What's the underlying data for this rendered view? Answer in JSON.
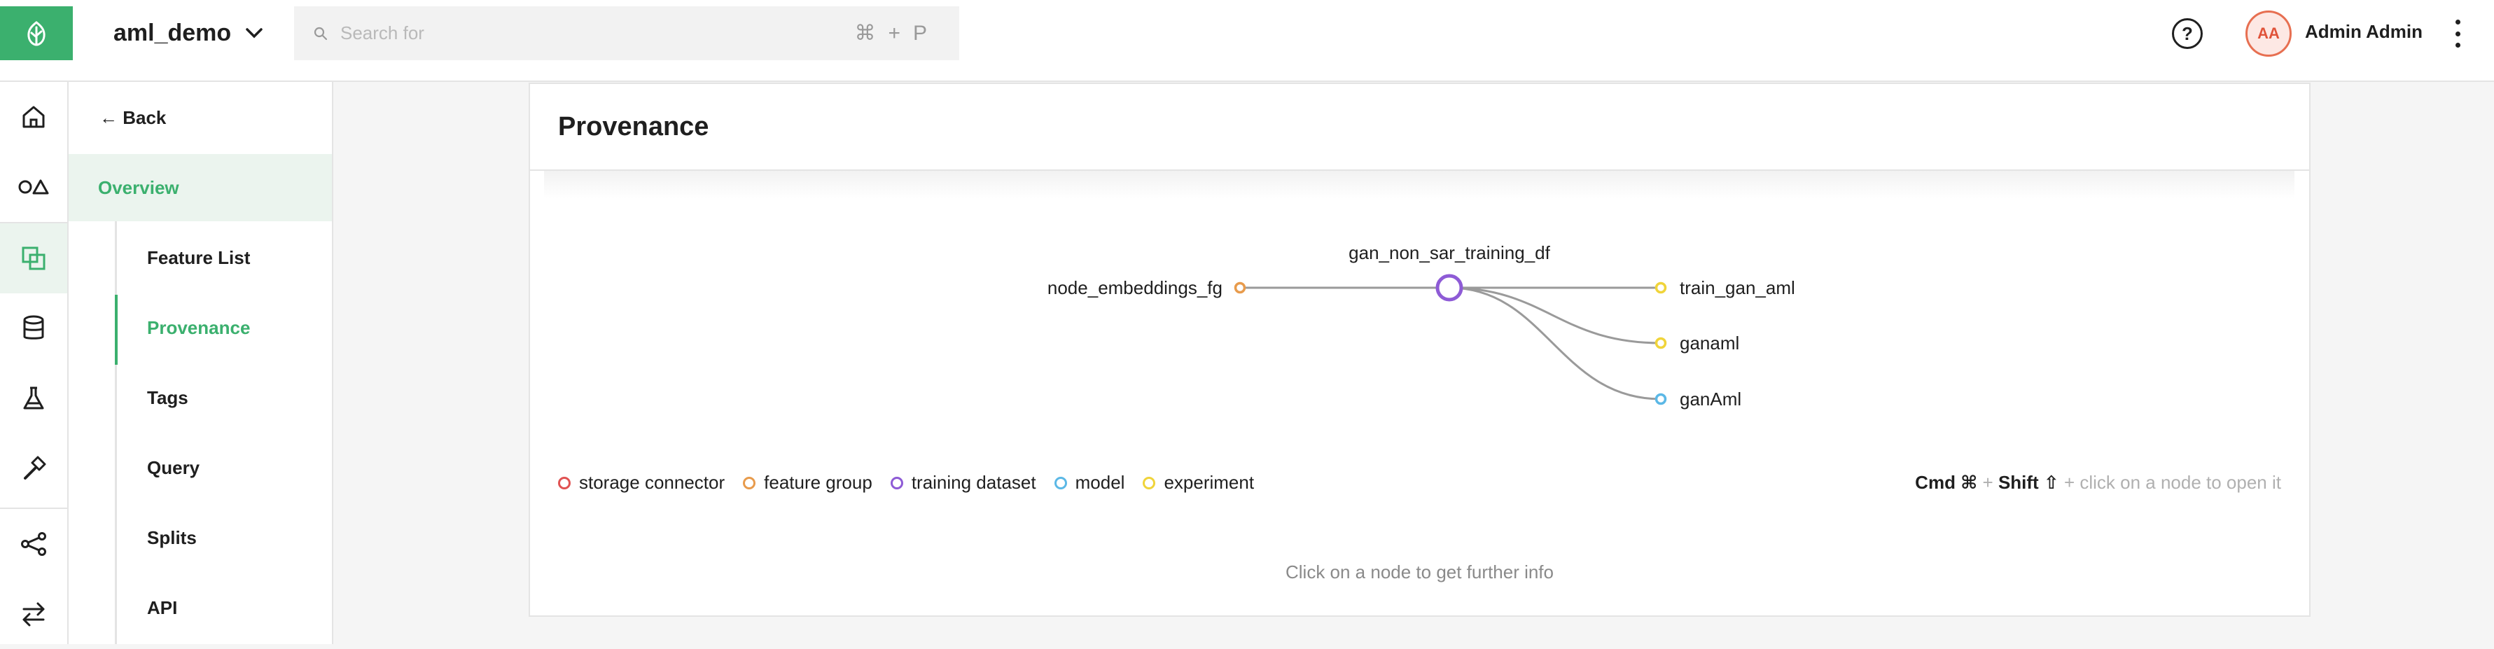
{
  "header": {
    "project_name": "aml_demo",
    "search_placeholder": "Search for",
    "search_shortcut": "⌘+P",
    "help_symbol": "?",
    "user_initials": "AA",
    "user_name": "Admin Admin"
  },
  "rail": {
    "items": [
      {
        "icon": "home-icon"
      },
      {
        "icon": "shapes-icon"
      },
      {
        "icon": "feature-store-icon",
        "active": true
      },
      {
        "icon": "database-icon"
      },
      {
        "icon": "experiment-flask-icon"
      },
      {
        "icon": "hammer-icon"
      },
      {
        "icon": "pipeline-icon"
      },
      {
        "icon": "transfer-arrows-icon"
      }
    ]
  },
  "subnav": {
    "back_label": "Back",
    "overview_label": "Overview",
    "items": [
      {
        "label": "Feature List"
      },
      {
        "label": "Provenance",
        "active": true
      },
      {
        "label": "Tags"
      },
      {
        "label": "Query"
      },
      {
        "label": "Splits"
      },
      {
        "label": "API"
      }
    ]
  },
  "main": {
    "title": "Provenance",
    "graph": {
      "source_node": {
        "label": "node_embeddings_fg",
        "type": "feature group"
      },
      "center_node": {
        "label": "gan_non_sar_training_df",
        "type": "training dataset"
      },
      "targets": [
        {
          "label": "train_gan_aml",
          "type": "experiment"
        },
        {
          "label": "ganaml",
          "type": "experiment"
        },
        {
          "label": "ganAml",
          "type": "model"
        }
      ]
    },
    "legend": [
      {
        "label": "storage connector",
        "color": "#e05252"
      },
      {
        "label": "feature group",
        "color": "#e89b4c"
      },
      {
        "label": "training dataset",
        "color": "#8e5bd6"
      },
      {
        "label": "model",
        "color": "#5bb8e6"
      },
      {
        "label": "experiment",
        "color": "#f0d43a"
      }
    ],
    "hint": {
      "cmd": "Cmd ⌘",
      "plus1": " + ",
      "shift": "Shift ⇧",
      "rest": " + click on a node to open it"
    },
    "footer_info": "Click on a node to get further info"
  },
  "colors": {
    "accent": "#3bb06e",
    "feature_group": "#e89b4c",
    "training_dataset": "#8e5bd6",
    "model": "#5bb8e6",
    "experiment": "#f0d43a"
  }
}
